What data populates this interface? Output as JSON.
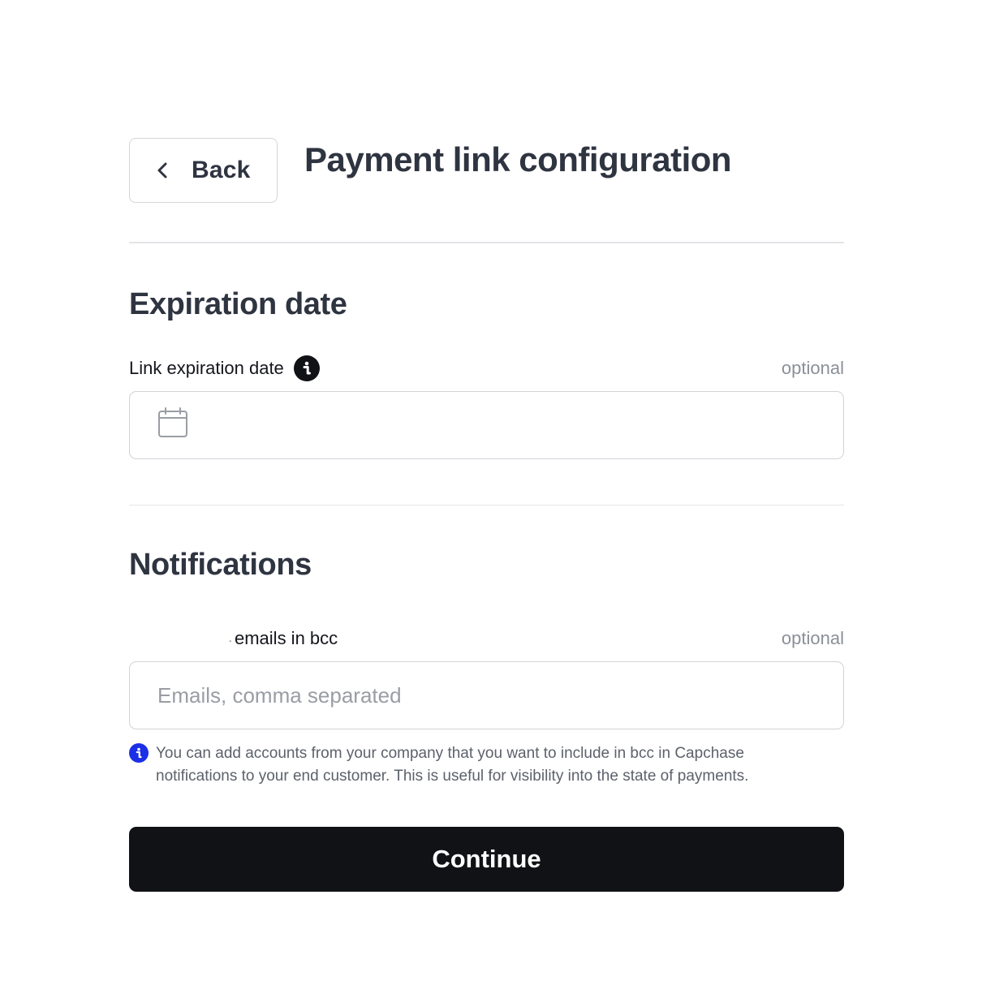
{
  "header": {
    "back_label": "Back",
    "title": "Payment link configuration"
  },
  "expiration": {
    "section_title": "Expiration date",
    "field_label": "Link expiration date",
    "optional_label": "optional",
    "value": "",
    "icon": "calendar-icon"
  },
  "notifications": {
    "section_title": "Notifications",
    "field_label_prefix": ".",
    "field_label": "emails in bcc",
    "optional_label": "optional",
    "placeholder": "Emails, comma separated",
    "value": "",
    "help_text": "You can add accounts from your company that you want to include in bcc in Capchase notifications to your end customer. This is useful for visibility into the state of payments."
  },
  "actions": {
    "continue_label": "Continue"
  },
  "colors": {
    "primary_button": "#111216",
    "info_accent": "#1a2fe6",
    "text_heading": "#2f3441",
    "text_muted": "#8b8f98"
  }
}
